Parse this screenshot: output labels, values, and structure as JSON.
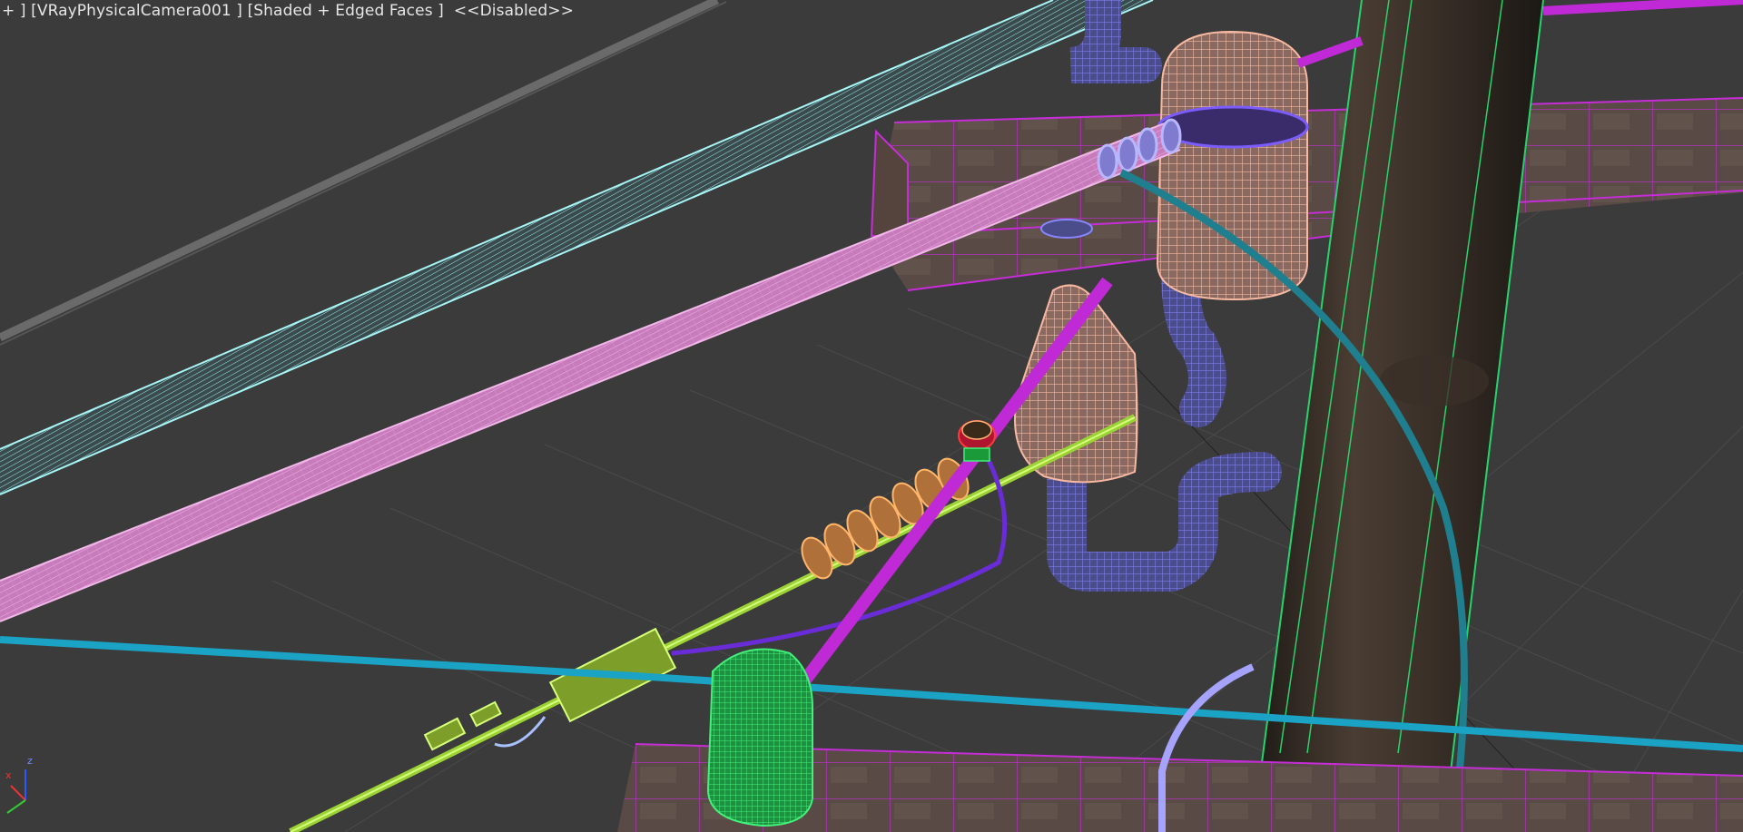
{
  "viewport": {
    "label": {
      "menu": "+ ]",
      "camera": "[VRayPhysicalCamera001 ]",
      "shading": "[Shaded + Edged Faces ]",
      "status": "<<Disabled>>"
    },
    "gizmo": {
      "x": "x",
      "z": "z"
    }
  },
  "colors": {
    "background": "#3b3b3b",
    "grid": "#4b4b4b",
    "cable_pink": "#e59ad8",
    "cable_cyan": "#8fe7e7",
    "cable_lime": "#b6f03a",
    "beam_magenta": "#c02ad6",
    "insulator_peach": "#f6b39c",
    "bracket_blue": "#6f6cf0",
    "blue_line": "#1aa3c4",
    "teal_wire": "#1f7f8f",
    "pole": "#3a2f26",
    "green_insulator": "#2fd35e"
  }
}
